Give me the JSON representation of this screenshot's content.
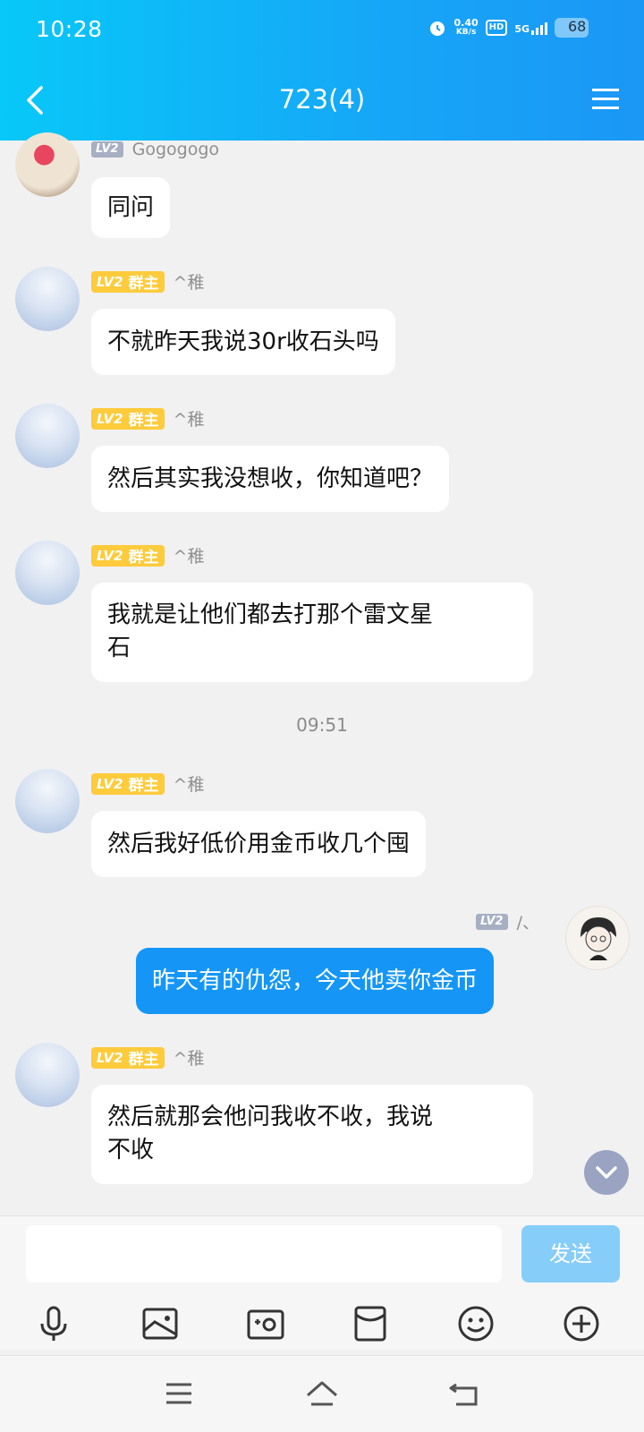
{
  "status_bar": {
    "time": "10:28",
    "speed_value": "0.40",
    "speed_unit": "KB/s",
    "hd": "HD",
    "network": "5G",
    "battery": "68"
  },
  "header": {
    "title": "723(4)"
  },
  "messages": [
    {
      "level": "LV2",
      "role": "",
      "nickname": "Gogogogo",
      "text": "同问"
    },
    {
      "level": "LV2",
      "role": "群主",
      "nickname": "^稚",
      "text": "不就昨天我说30r收石头吗"
    },
    {
      "level": "LV2",
      "role": "群主",
      "nickname": "^稚",
      "text": "然后其实我没想收，你知道吧？"
    },
    {
      "level": "LV2",
      "role": "群主",
      "nickname": "^稚",
      "text_line1": "我就是让他们都去打那个雷文星",
      "text_line2": "石"
    },
    {
      "level": "LV2",
      "role": "群主",
      "nickname": "^稚",
      "text": "然后我好低价用金币收几个囤"
    },
    {
      "level": "LV2",
      "role": "",
      "nickname": "/、",
      "text": "昨天有的仇怨，今天他卖你金币"
    },
    {
      "level": "LV2",
      "role": "群主",
      "nickname": "^稚",
      "text_line1": "然后就那会他问我收不收，我说",
      "text_line2": "不收"
    }
  ],
  "timestamp": "09:51",
  "input": {
    "placeholder": "",
    "send_label": "发送"
  },
  "toolbar_icons": [
    "microphone-icon",
    "image-icon",
    "camera-icon",
    "red-packet-icon",
    "emoji-icon",
    "plus-icon"
  ],
  "system_nav_icons": [
    "menu-icon",
    "home-icon",
    "back-icon"
  ],
  "colors": {
    "header_gradient_start": "#08c8f8",
    "header_gradient_end": "#1b97f6",
    "my_bubble": "#1596f7",
    "owner_badge": "#fdcb3c",
    "level_badge": "#a7afc3",
    "background": "#f1f1f1"
  }
}
